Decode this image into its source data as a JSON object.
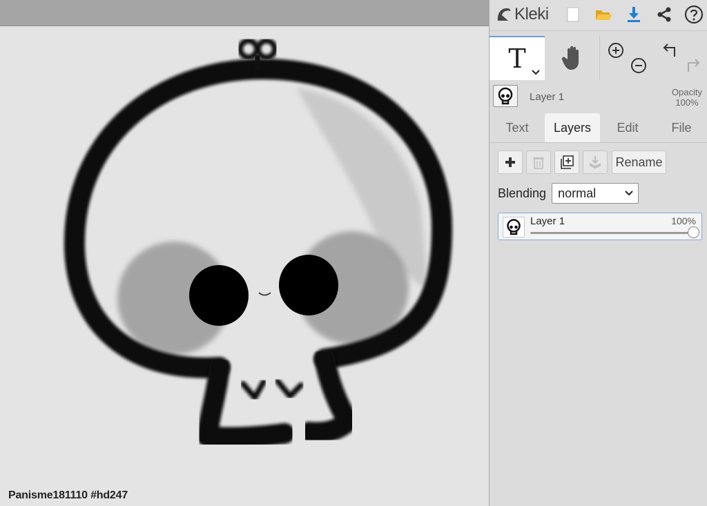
{
  "app": {
    "name": "Kleki"
  },
  "canvas": {
    "watermark": "Panisme181110 #hd247"
  },
  "toolbar": {
    "new_icon": "blank-page-icon",
    "open_icon": "folder-icon",
    "save_icon": "download-icon",
    "share_icon": "share-icon",
    "help_icon": "help-icon"
  },
  "tools": {
    "text_glyph": "T",
    "active": "text"
  },
  "layer_info": {
    "name": "Layer 1",
    "opacity_label": "Opacity",
    "opacity_value": "100%"
  },
  "tabs": [
    {
      "label": "Text"
    },
    {
      "label": "Layers"
    },
    {
      "label": "Edit"
    },
    {
      "label": "File"
    }
  ],
  "active_tab": "Layers",
  "layers_panel": {
    "rename_label": "Rename",
    "blending_label": "Blending",
    "blending_value": "normal",
    "layers": [
      {
        "name": "Layer 1",
        "opacity_text": "100%",
        "opacity": 1.0
      }
    ]
  },
  "colors": {
    "accent": "#6b9be0",
    "panel_bg": "#dcdcdc",
    "canvas_bg": "#e4e4e4",
    "download_blue": "#1e7fd6",
    "folder_yellow": "#f2b92b"
  }
}
